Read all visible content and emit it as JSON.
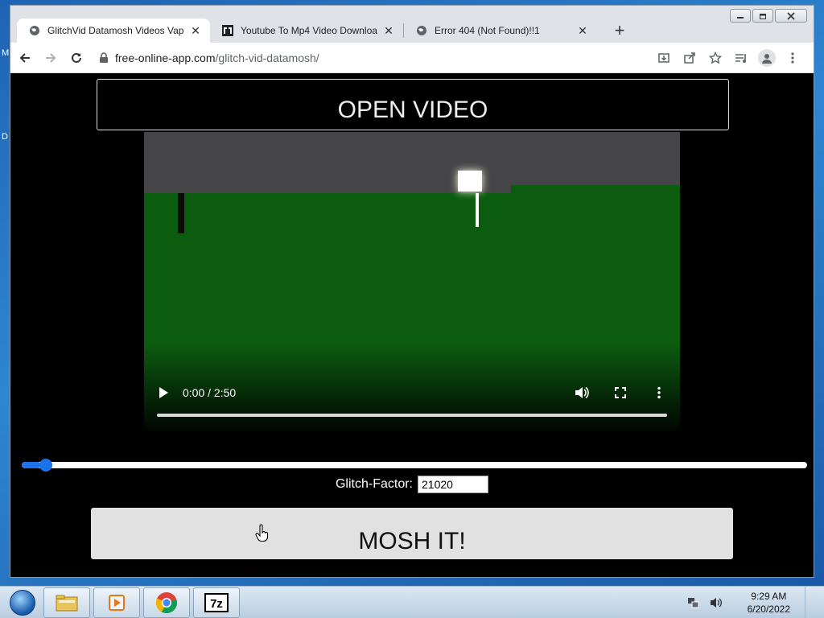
{
  "browser": {
    "tabs": [
      {
        "title": "GlitchVid Datamosh Videos Vapo",
        "favicon": "globe-icon",
        "active": true
      },
      {
        "title": "Youtube To Mp4 Video Downloa",
        "favicon": "yt-downloader-icon",
        "active": false
      },
      {
        "title": "Error 404 (Not Found)!!1",
        "favicon": "globe-icon",
        "active": false
      }
    ],
    "new_tab_label": "+",
    "url_host": "free-online-app.com",
    "url_path": "/glitch-vid-datamosh/",
    "toolbar_icons": [
      "download-icon",
      "share-icon",
      "star-icon",
      "media-controls-icon",
      "profile-icon",
      "menu-icon"
    ]
  },
  "page": {
    "open_video_label": "OPEN VIDEO",
    "video": {
      "time_display": "0:00 / 2:50",
      "progress_fraction": 0
    },
    "glitch_slider_fraction": 0.025,
    "factor_label": "Glitch-Factor:",
    "factor_value": "21020",
    "mosh_label": "MOSH IT!"
  },
  "desktop": {
    "left_letters": [
      "M",
      "D"
    ]
  },
  "taskbar": {
    "apps": [
      "file-explorer-icon",
      "media-player-icon",
      "chrome-icon",
      "7zip-icon"
    ],
    "time": "9:29 AM",
    "date": "6/20/2022"
  },
  "colors": {
    "accent": "#1a73e8",
    "video_green": "#0c5c10",
    "page_bg": "#000000"
  }
}
